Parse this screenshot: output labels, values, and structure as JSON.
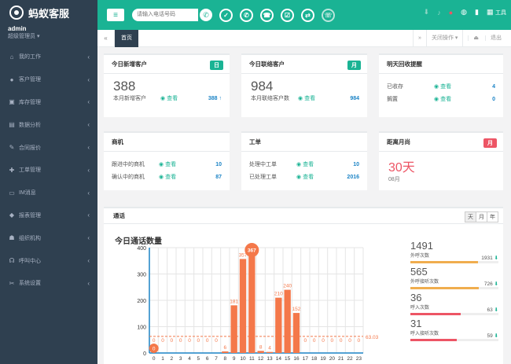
{
  "app": {
    "title": "蚂蚁客服"
  },
  "profile": {
    "name": "admin",
    "role": "超级管理员 ▾"
  },
  "menu": [
    {
      "label": "我的工作",
      "icon": "home-icon"
    },
    {
      "label": "客户管理",
      "icon": "user-icon"
    },
    {
      "label": "库存管理",
      "icon": "box-icon"
    },
    {
      "label": "数据分析",
      "icon": "chart-icon"
    },
    {
      "label": "合同报价",
      "icon": "contract-icon"
    },
    {
      "label": "工单管理",
      "icon": "ticket-icon"
    },
    {
      "label": "IM消息",
      "icon": "message-icon"
    },
    {
      "label": "报表管理",
      "icon": "report-icon"
    },
    {
      "label": "组织机构",
      "icon": "org-icon"
    },
    {
      "label": "呼叫中心",
      "icon": "headset-icon"
    },
    {
      "label": "系统设置",
      "icon": "wrench-icon"
    }
  ],
  "topbar": {
    "search_placeholder": "请输入电话号码",
    "tools_label": "工具"
  },
  "tabs": {
    "home": "首页",
    "close_ops": "关闭操作 ▾",
    "logout": "退出"
  },
  "cards": {
    "new_customers": {
      "title": "今日新增客户",
      "badge": "日",
      "big": "388",
      "label": "本月新增客户",
      "view": "查看",
      "value": "388"
    },
    "contacts": {
      "title": "今日联络客户",
      "badge": "月",
      "big": "984",
      "label": "本月联络客户数",
      "view": "查看",
      "value": "984"
    },
    "payment": {
      "title": "明天回收提醒",
      "rows": [
        {
          "label": "已收存",
          "view": "查看",
          "value": "4"
        },
        {
          "label": "搁置",
          "view": "查看",
          "value": "0"
        }
      ]
    },
    "opportunity": {
      "title": "商机",
      "rows": [
        {
          "label": "跟进中的商机",
          "view": "查看",
          "value": "10"
        },
        {
          "label": "确认中的商机",
          "view": "查看",
          "value": "87"
        }
      ]
    },
    "tickets": {
      "title": "工单",
      "rows": [
        {
          "label": "处理中工单",
          "view": "查看",
          "value": "10"
        },
        {
          "label": "已处理工单",
          "view": "查看",
          "value": "2016"
        }
      ]
    },
    "expiry": {
      "title": "距离月尚",
      "badge": "月",
      "days": "30天",
      "month": "08月"
    }
  },
  "calls": {
    "title": "通话",
    "periods": [
      "天",
      "月",
      "年"
    ],
    "stats": [
      {
        "value": "1491",
        "label": "外呼次数",
        "right": "1931",
        "fill": 0.77,
        "color": "#f0ad4e"
      },
      {
        "value": "565",
        "label": "外呼接听次数",
        "right": "726",
        "fill": 0.78,
        "color": "#f0ad4e"
      },
      {
        "value": "36",
        "label": "呼入次数",
        "right": "63",
        "fill": 0.57,
        "color": "#ed5565"
      },
      {
        "value": "31",
        "label": "呼入接听次数",
        "right": "59",
        "fill": 0.53,
        "color": "#ed5565"
      }
    ]
  },
  "chart_data": {
    "type": "bar",
    "title": "今日通话数量",
    "categories": [
      "0",
      "1",
      "2",
      "3",
      "4",
      "5",
      "6",
      "7",
      "8",
      "9",
      "10",
      "11",
      "12",
      "13",
      "14",
      "15",
      "16",
      "17",
      "18",
      "19",
      "20",
      "21",
      "22",
      "23"
    ],
    "values": [
      0,
      0,
      0,
      0,
      0,
      0,
      0,
      0,
      6,
      181,
      357,
      367,
      8,
      4,
      210,
      240,
      152,
      0,
      0,
      0,
      0,
      0,
      0,
      0
    ],
    "ylim": [
      0,
      400
    ],
    "yticks": [
      0,
      100,
      200,
      300,
      400
    ],
    "average": 63.03,
    "max_marker": "367",
    "min_marker": "0",
    "bar_color": "#f4784a"
  }
}
